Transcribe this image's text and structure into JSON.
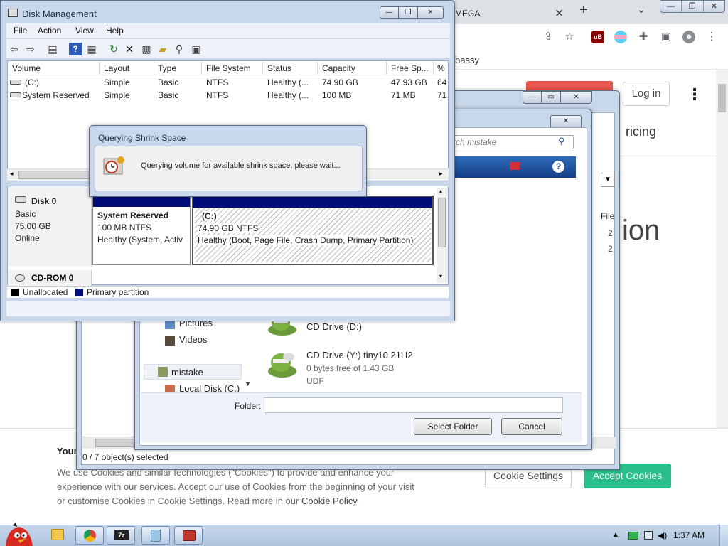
{
  "chrome": {
    "tab_title": "MEGA",
    "tab_close": "✕",
    "new_tab": "+",
    "tab_search": "⌄",
    "win_buttons": [
      "—",
      "❐",
      "✕"
    ],
    "bookmark_text": "bassy",
    "login": "Log in",
    "kebab": "⋮",
    "pricing": "ricing",
    "big_text": "ion",
    "file_col": "File",
    "file_val1": "2",
    "file_val2": "2",
    "cookie": {
      "title": "Your",
      "text_line1": "We use Cookies and similar technologies (\"Cookies\") to provide and enhance your",
      "text_line2": "experience with our services. Accept our use of Cookies from the beginning of your visit",
      "text_line3": "or customise Cookies in Cookie Settings. Read more in our",
      "link": "Cookie Policy",
      "link_suffix": ".",
      "settings_button": "Cookie Settings",
      "accept_button": "Accept Cookies"
    }
  },
  "explorer": {
    "status": "0 / 7 object(s) selected"
  },
  "folder_dialog": {
    "search_placeholder": "rch mistake",
    "nav_items": [
      "Pictures",
      "Videos",
      "mistake",
      "Local Disk (C:)"
    ],
    "drives": [
      {
        "name": "CD Drive (D:)",
        "sub1": "",
        "sub2": ""
      },
      {
        "name": "CD Drive (Y:) tiny10 21H2",
        "sub1": "0 bytes free of 1.43 GB",
        "sub2": "UDF"
      }
    ],
    "folder_label": "Folder:",
    "folder_value": "",
    "select_button": "Select Folder",
    "cancel_button": "Cancel"
  },
  "disk_management": {
    "title": "Disk Management",
    "menu": [
      "File",
      "Action",
      "View",
      "Help"
    ],
    "columns": [
      "Volume",
      "Layout",
      "Type",
      "File System",
      "Status",
      "Capacity",
      "Free Sp...",
      "%"
    ],
    "rows": [
      [
        "(C:)",
        "Simple",
        "Basic",
        "NTFS",
        "Healthy (...",
        "74.90 GB",
        "47.93 GB",
        "64"
      ],
      [
        "System Reserved",
        "Simple",
        "Basic",
        "NTFS",
        "Healthy (...",
        "100 MB",
        "71 MB",
        "71"
      ]
    ],
    "disk0": {
      "name": "Disk 0",
      "type": "Basic",
      "size": "75.00 GB",
      "state": "Online"
    },
    "partitions": [
      {
        "name": "System Reserved",
        "size": "100 MB NTFS",
        "status": "Healthy (System, Activ"
      },
      {
        "name": "(C:)",
        "size": "74.90 GB NTFS",
        "status": "Healthy (Boot, Page File, Crash Dump, Primary Partition)"
      }
    ],
    "cdrom": "CD-ROM 0",
    "legend": [
      {
        "label": "Unallocated",
        "color": "#000000"
      },
      {
        "label": "Primary partition",
        "color": "#000e7a"
      }
    ]
  },
  "query_dialog": {
    "title": "Querying Shrink Space",
    "message": "Querying volume for available shrink space, please wait..."
  },
  "taskbar": {
    "tray_up": "▲",
    "time": "1:37 AM"
  },
  "colors": {
    "accent_red": "#e8564f",
    "accept_green": "#2bbf8c",
    "partition_blue": "#000e7a"
  }
}
